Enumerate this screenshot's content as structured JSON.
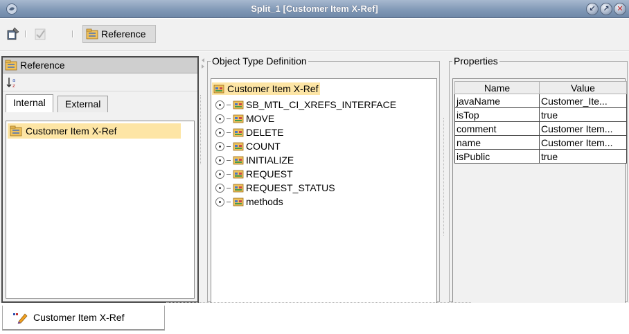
{
  "window": {
    "title": "Split_1 [Customer Item X-Ref]",
    "controls": [
      "minimize-icon",
      "maximize-icon",
      "close-icon"
    ]
  },
  "toolbar": {
    "reference_label": "Reference"
  },
  "left_panel": {
    "header": "Reference",
    "tabs": [
      {
        "label": "Internal",
        "active": true
      },
      {
        "label": "External",
        "active": false
      }
    ],
    "items": [
      {
        "label": "Customer Item X-Ref",
        "selected": true
      }
    ]
  },
  "object_type_definition": {
    "legend": "Object Type Definition",
    "root": "Customer Item X-Ref",
    "nodes": [
      "SB_MTL_CI_XREFS_INTERFACE",
      "MOVE",
      "DELETE",
      "COUNT",
      "INITIALIZE",
      "REQUEST",
      "REQUEST_STATUS",
      "methods"
    ]
  },
  "properties": {
    "legend": "Properties",
    "columns": [
      "Name",
      "Value"
    ],
    "rows": [
      {
        "name": "javaName",
        "value": "Customer_Ite..."
      },
      {
        "name": "isTop",
        "value": "true"
      },
      {
        "name": "comment",
        "value": "Customer Item..."
      },
      {
        "name": "name",
        "value": "Customer Item..."
      },
      {
        "name": "isPublic",
        "value": "true"
      }
    ]
  },
  "bottom_tabs": [
    {
      "label": "Customer Item X-Ref"
    }
  ],
  "colors": {
    "titlebar": "#7f97b5",
    "selection": "#fde5a5",
    "folder_icon": "#e8a531"
  }
}
